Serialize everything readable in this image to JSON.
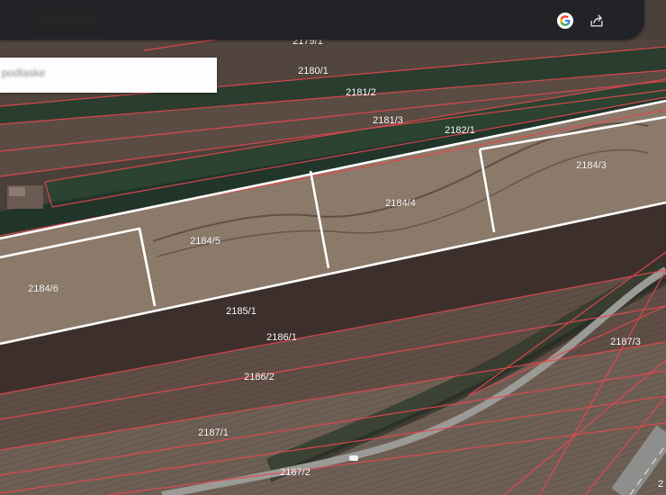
{
  "header": {
    "title": "",
    "google_icon": "google-g-icon",
    "share_icon": "share-icon"
  },
  "search": {
    "value": "podlaske"
  },
  "colors": {
    "boundary_red": "#e8474f",
    "highlight_white": "#ffffff",
    "field_brown": "#6b5a4d",
    "crop_green": "#23402a",
    "label_white": "#ffffff"
  },
  "parcels": [
    "2179/1",
    "2180/1",
    "2181/2",
    "2181/3",
    "2182/1",
    "2184/3",
    "2184/4",
    "2184/5",
    "2184/6",
    "2185/1",
    "2186/1",
    "2186/2",
    "2187/1",
    "2187/2",
    "2187/3",
    "2"
  ]
}
